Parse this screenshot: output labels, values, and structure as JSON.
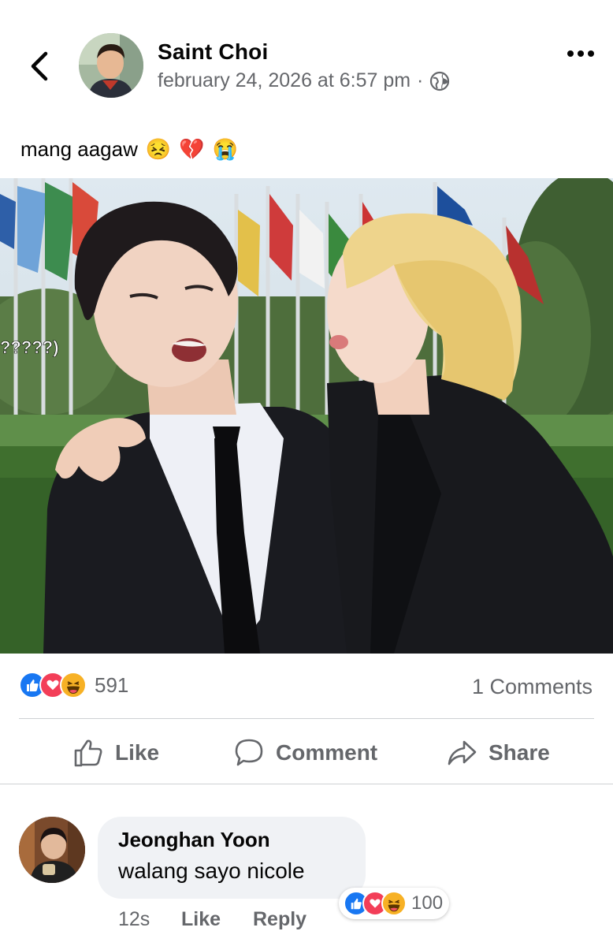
{
  "post": {
    "author": "Saint Choi",
    "timestamp": "february 24, 2026 at 6:57 pm",
    "separator": "·",
    "audience_icon": "globe-icon",
    "caption": "mang aagaw",
    "caption_emojis": [
      "😣",
      "💔",
      "😭"
    ]
  },
  "photo": {
    "overlay_text": "?????)"
  },
  "stats": {
    "reaction_icons": [
      "like",
      "love",
      "haha"
    ],
    "reaction_count": "591",
    "comments_label": "1 Comments"
  },
  "actions": {
    "like_label": "Like",
    "comment_label": "Comment",
    "share_label": "Share"
  },
  "comment": {
    "author": "Jeonghan Yoon",
    "text": "walang sayo nicole",
    "time": "12s",
    "like_label": "Like",
    "reply_label": "Reply",
    "reaction_icons": [
      "like",
      "love",
      "haha"
    ],
    "reaction_count": "100"
  },
  "colors": {
    "like_blue": "#1877f2",
    "love_red": "#f33e58",
    "haha_yellow": "#f7b125",
    "secondary_text": "#65676b",
    "bubble_bg": "#f0f2f5"
  }
}
